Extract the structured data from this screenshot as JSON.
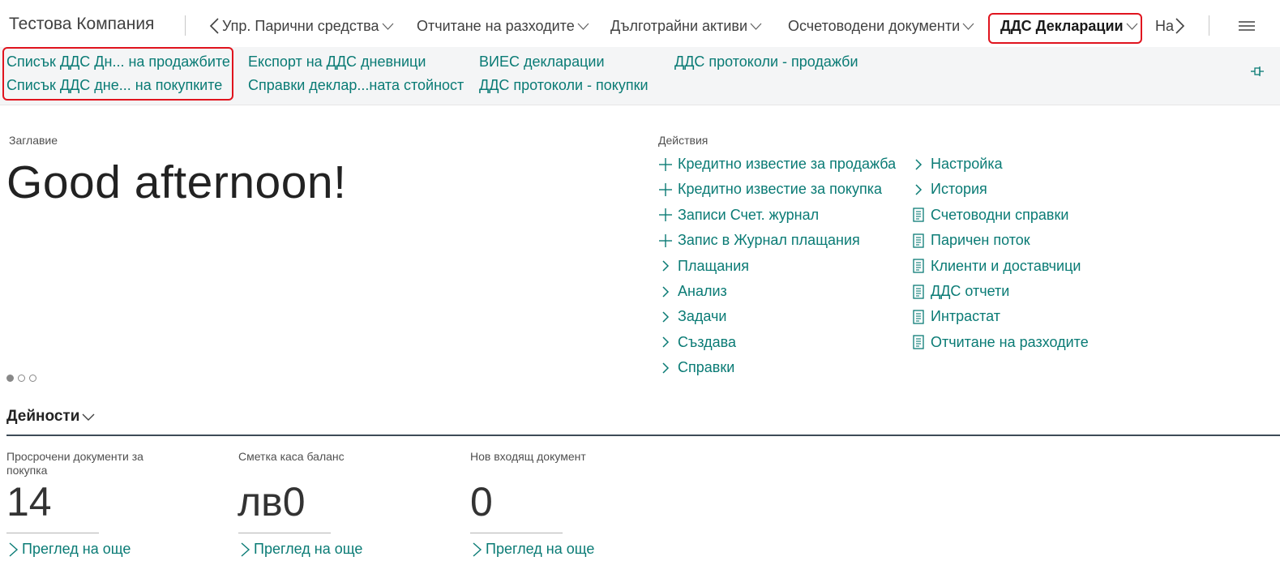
{
  "company": "Тестова Компания",
  "nav": {
    "items": [
      {
        "label": "Упр. Парични средства"
      },
      {
        "label": "Отчитане на разходите"
      },
      {
        "label": "Дълготрайни активи"
      },
      {
        "label": "Осчетоводени документи"
      },
      {
        "label": "ДДС Декларации"
      },
      {
        "label": "На"
      }
    ],
    "icons": {
      "back": "chevron-left-icon",
      "forward": "chevron-right-icon",
      "menu": "hamburger-icon"
    }
  },
  "subnav": {
    "links": [
      "Списък ДДС Дн... на продажбите",
      "Списък ДДС дне... на покупките",
      "Експорт на ДДС дневници",
      "Справки деклар...ната стойност",
      "ВИЕС декларации",
      "ДДС протоколи - покупки",
      "ДДС протоколи - продажби"
    ],
    "pin_icon": "pin-icon"
  },
  "headline": {
    "caption": "Заглавие",
    "greeting": "Good afternoon!"
  },
  "actions": {
    "caption": "Действия",
    "col1": [
      {
        "icon": "plus-icon",
        "label": "Кредитно известие за продажба"
      },
      {
        "icon": "plus-icon",
        "label": "Кредитно известие за покупка"
      },
      {
        "icon": "plus-icon",
        "label": "Записи Счет. журнал"
      },
      {
        "icon": "plus-icon",
        "label": "Запис в Журнал плащания"
      },
      {
        "icon": "chevron-right-icon",
        "label": "Плащания"
      },
      {
        "icon": "chevron-right-icon",
        "label": "Анализ"
      },
      {
        "icon": "chevron-right-icon",
        "label": "Задачи"
      },
      {
        "icon": "chevron-right-icon",
        "label": "Създава"
      },
      {
        "icon": "chevron-right-icon",
        "label": "Справки"
      }
    ],
    "col2": [
      {
        "icon": "chevron-right-icon",
        "label": "Настройка"
      },
      {
        "icon": "chevron-right-icon",
        "label": "История"
      },
      {
        "icon": "report-icon",
        "label": "Счетоводни справки"
      },
      {
        "icon": "report-icon",
        "label": "Паричен поток"
      },
      {
        "icon": "report-icon",
        "label": "Клиенти и доставчици"
      },
      {
        "icon": "report-icon",
        "label": "ДДС отчети"
      },
      {
        "icon": "report-icon",
        "label": "Интрастат"
      },
      {
        "icon": "report-icon",
        "label": "Отчитане на разходите"
      }
    ]
  },
  "activities": {
    "title": "Дейности",
    "cues": [
      {
        "label": "Просрочени документи за покупка",
        "value": "14",
        "more": "Преглед на още"
      },
      {
        "label": "Сметка каса баланс",
        "value": "лв0",
        "more": "Преглед на още"
      },
      {
        "label": "Нов входящ документ",
        "value": "0",
        "more": "Преглед на още"
      }
    ]
  },
  "colors": {
    "link": "#0a7b75",
    "highlight": "#e0141e",
    "subbar": "#f4f5f6"
  }
}
